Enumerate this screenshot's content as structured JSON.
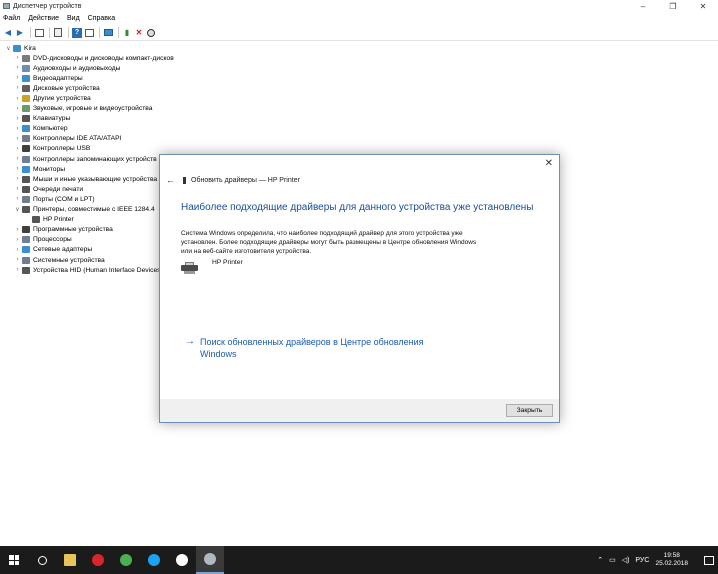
{
  "window": {
    "title": "Диспетчер устройств"
  },
  "win_controls": {
    "minimize": "–",
    "restore": "❐",
    "close": "✕"
  },
  "menu": [
    "Файл",
    "Действие",
    "Вид",
    "Справка"
  ],
  "tree": {
    "root": "Kira",
    "items": [
      {
        "label": "DVD-дисководы и дисководы компакт-дисков",
        "icon": "dvd-drive-icon",
        "color": "#7a7a7a",
        "expanded": false
      },
      {
        "label": "Аудиовходы и аудиовыходы",
        "icon": "audio-icon",
        "color": "#6f8fb0",
        "expanded": false
      },
      {
        "label": "Видеоадаптеры",
        "icon": "display-adapter-icon",
        "color": "#3a8fcf",
        "expanded": false
      },
      {
        "label": "Дисковые устройства",
        "icon": "disk-drive-icon",
        "color": "#606060",
        "expanded": false
      },
      {
        "label": "Другие устройства",
        "icon": "unknown-device-icon",
        "color": "#c9a227",
        "expanded": false
      },
      {
        "label": "Звуковые, игровые и видеоустройства",
        "icon": "sound-icon",
        "color": "#6a9a6a",
        "expanded": false
      },
      {
        "label": "Клавиатуры",
        "icon": "keyboard-icon",
        "color": "#555555",
        "expanded": false
      },
      {
        "label": "Компьютер",
        "icon": "computer-icon",
        "color": "#3a8fcf",
        "expanded": false
      },
      {
        "label": "Контроллеры IDE ATA/ATAPI",
        "icon": "ide-controller-icon",
        "color": "#6f7f8f",
        "expanded": false
      },
      {
        "label": "Контроллеры USB",
        "icon": "usb-icon",
        "color": "#404040",
        "expanded": false
      },
      {
        "label": "Контроллеры запоминающих устройств",
        "icon": "storage-controller-icon",
        "color": "#6f7f8f",
        "expanded": false
      },
      {
        "label": "Мониторы",
        "icon": "monitor-icon",
        "color": "#3a8fcf",
        "expanded": false
      },
      {
        "label": "Мыши и иные указывающие устройства",
        "icon": "mouse-icon",
        "color": "#555555",
        "expanded": false
      },
      {
        "label": "Очереди печати",
        "icon": "print-queue-icon",
        "color": "#555555",
        "expanded": false
      },
      {
        "label": "Порты (COM и LPT)",
        "icon": "port-icon",
        "color": "#6f7f8f",
        "expanded": false
      },
      {
        "label": "Принтеры, совместимые с IEEE 1284.4",
        "icon": "printer-icon",
        "color": "#555555",
        "expanded": true
      },
      {
        "label": "HP Printer",
        "icon": "printer-device-icon",
        "color": "#555555",
        "child": true
      },
      {
        "label": "Программные устройства",
        "icon": "software-device-icon",
        "color": "#404040",
        "expanded": false
      },
      {
        "label": "Процессоры",
        "icon": "processor-icon",
        "color": "#6f7f8f",
        "expanded": false
      },
      {
        "label": "Сетевые адаптеры",
        "icon": "network-adapter-icon",
        "color": "#3a8fcf",
        "expanded": false
      },
      {
        "label": "Системные устройства",
        "icon": "system-device-icon",
        "color": "#6f7f8f",
        "expanded": false
      },
      {
        "label": "Устройства HID (Human Interface Devices)",
        "icon": "hid-icon",
        "color": "#555555",
        "expanded": false
      }
    ]
  },
  "dialog": {
    "header": "Обновить драйверы — HP Printer",
    "heading": "Наиболее подходящие драйверы для данного устройства уже установлены",
    "description": "Система Windows определила, что наиболее подходящий драйвер для этого устройства уже установлен. Более подходящие драйверы могут быть размещены в Центре обновления Windows или на веб-сайте изготовителя устройства.",
    "device_name": "HP Printer",
    "link": "Поиск обновленных драйверов в Центре обновления Windows",
    "close_button": "Закрыть"
  },
  "taskbar": {
    "apps": [
      {
        "name": "search-icon",
        "color": "#ffffff"
      },
      {
        "name": "file-explorer-icon",
        "color": "#e8c55a"
      },
      {
        "name": "opera-icon",
        "color": "#d7262b"
      },
      {
        "name": "chrome-icon",
        "color": "#4caf50"
      },
      {
        "name": "skype-icon",
        "color": "#1da1f2"
      },
      {
        "name": "yandex-browser-icon",
        "color": "#ffffff"
      },
      {
        "name": "device-manager-taskbar-icon",
        "color": "#b0b8c0"
      }
    ],
    "language": "РУС",
    "time": "19:58",
    "date": "25.02.2018"
  }
}
